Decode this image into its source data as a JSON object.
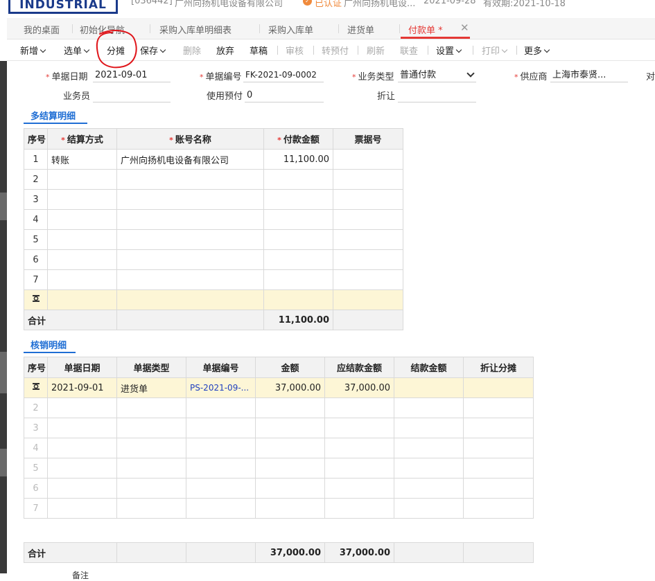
{
  "header": {
    "brand": "INDUSTRIAL",
    "company_code": "[036442]",
    "company_name": "广州向扬机电设备有限公司",
    "auth_status": "已认证",
    "auth_badge_icon": "certified-icon",
    "company_short": "广州向扬机电设...",
    "date": "2021-09-28",
    "expiry": "有效期:2021-10-18"
  },
  "tabs": [
    {
      "label": "我的桌面"
    },
    {
      "label": "初始化导航"
    },
    {
      "label": "采购入库单明细表"
    },
    {
      "label": "采购入库单"
    },
    {
      "label": "进货单"
    },
    {
      "label": "付款单 *"
    }
  ],
  "toolbar": {
    "new": "新增",
    "select_doc": "选单",
    "allocate": "分摊",
    "save": "保存",
    "delete": "删除",
    "abandon": "放弃",
    "draft": "草稿",
    "audit": "审核",
    "to_prepay": "转预付",
    "refresh": "刷新",
    "query": "联查",
    "settings": "设置",
    "print": "打印",
    "more": "更多"
  },
  "form": {
    "doc_date_label": "单据日期",
    "doc_date": "2021-09-01",
    "doc_no_label": "单据编号",
    "doc_no": "FK-2021-09-0002",
    "biz_type_label": "业务类型",
    "biz_type": "普通付款",
    "supplier_label": "供应商",
    "supplier": "上海市泰贤...",
    "cut_label": "对",
    "salesman_label": "业务员",
    "salesman": "",
    "prepay_label": "使用预付",
    "prepay": "0",
    "discount_label": "折让",
    "discount": ""
  },
  "settle": {
    "title": "多结算明细",
    "headers": [
      "序号",
      "结算方式",
      "账号名称",
      "付款金额",
      "票据号"
    ],
    "rows": [
      [
        "1",
        "转账",
        "广州向扬机电设备有限公司",
        "11,100.00",
        ""
      ],
      [
        "2",
        "",
        "",
        "",
        ""
      ],
      [
        "3",
        "",
        "",
        "",
        ""
      ],
      [
        "4",
        "",
        "",
        "",
        ""
      ],
      [
        "5",
        "",
        "",
        "",
        ""
      ],
      [
        "6",
        "",
        "",
        "",
        ""
      ],
      [
        "7",
        "",
        "",
        "",
        ""
      ]
    ],
    "total_label": "合计",
    "total_amount": "11,100.00"
  },
  "verify": {
    "title": "核销明细",
    "headers": [
      "序号",
      "单据日期",
      "单据类型",
      "单据编号",
      "金额",
      "应结款金额",
      "结款金额",
      "折让分摊"
    ],
    "rows": [
      [
        "2",
        "",
        "",
        "",
        "",
        "",
        "",
        ""
      ],
      [
        "3",
        "",
        "",
        "",
        "",
        "",
        "",
        ""
      ],
      [
        "4",
        "",
        "",
        "",
        "",
        "",
        "",
        ""
      ],
      [
        "5",
        "",
        "",
        "",
        "",
        "",
        "",
        ""
      ],
      [
        "6",
        "",
        "",
        "",
        "",
        "",
        "",
        ""
      ],
      [
        "7",
        "",
        "",
        "",
        "",
        "",
        "",
        ""
      ]
    ],
    "first_row": {
      "date": "2021-09-01",
      "type": "进货单",
      "doc_no": "PS-2021-09-...",
      "amount": "37,000.00",
      "due": "37,000.00",
      "settled": "",
      "discount": ""
    },
    "total_label": "合计",
    "total_amount": "37,000.00",
    "total_due": "37,000.00"
  },
  "footer": {
    "remark_label": "备注"
  },
  "colors": {
    "accent": "#e53935",
    "section": "#1f6ed4",
    "highlight_row": "#fdf6d6",
    "annotation": "#e0161b"
  }
}
